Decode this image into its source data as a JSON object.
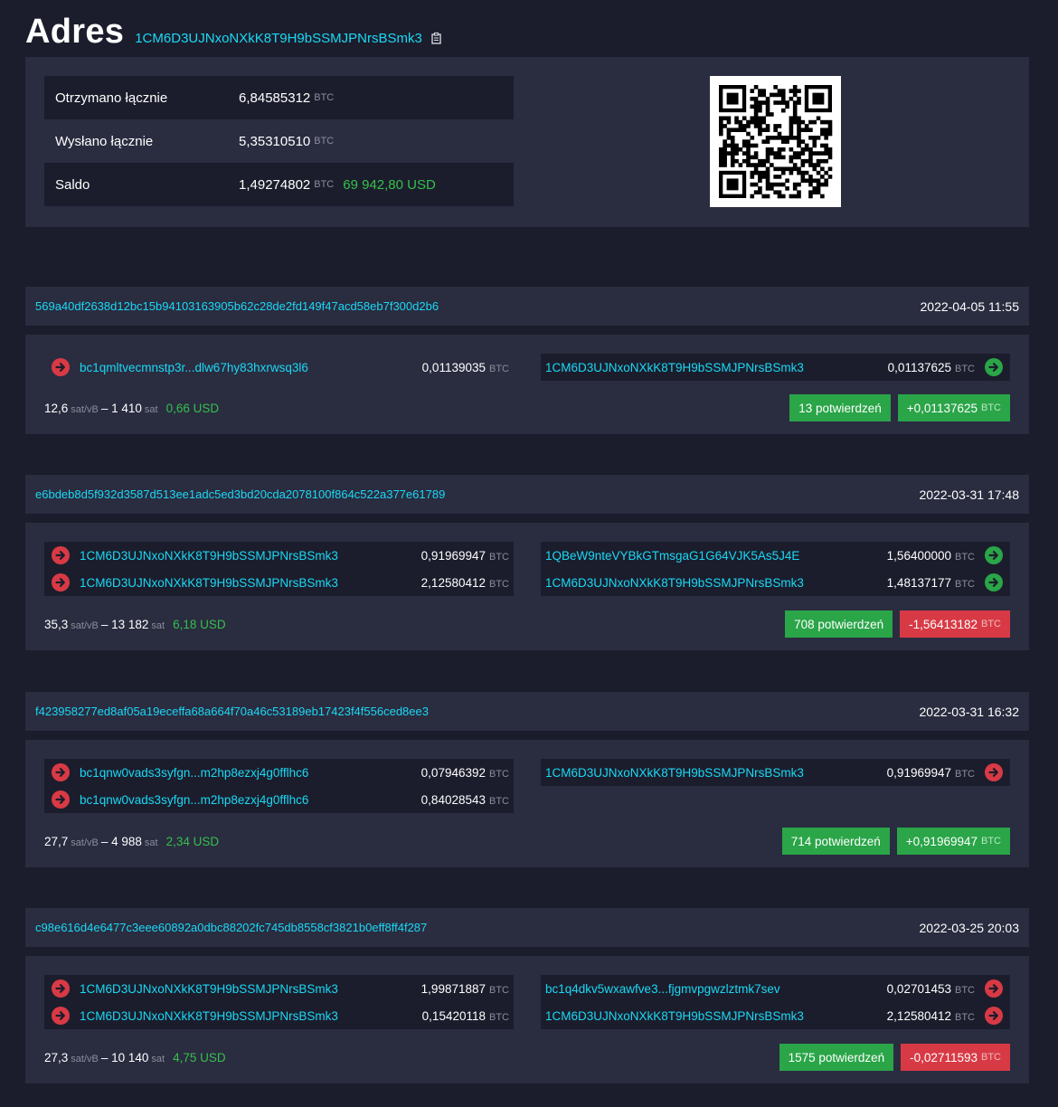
{
  "header": {
    "title": "Adres",
    "address": "1CM6D3UJNxoNXkK8T9H9bSSMJPNrsBSmk3"
  },
  "summary": {
    "rows": [
      {
        "label": "Otrzymano łącznie",
        "value": "6,84585312",
        "unit": "BTC",
        "usd": ""
      },
      {
        "label": "Wysłano łącznie",
        "value": "5,35310510",
        "unit": "BTC",
        "usd": ""
      },
      {
        "label": "Saldo",
        "value": "1,49274802",
        "unit": "BTC",
        "usd": "69 942,80 USD"
      }
    ]
  },
  "transactions": [
    {
      "txid": "569a40df2638d12bc15b94103163905b62c28de2fd149f47acd58eb7f300d2b6",
      "date": "2022-04-05 11:55",
      "inputs": [
        {
          "address": "bc1qmltvecmnstp3r...dlw67hy83hxrwsq3l6",
          "amount": "0,01139035",
          "unit": "BTC"
        }
      ],
      "outputs": [
        {
          "address": "1CM6D3UJNxoNXkK8T9H9bSSMJPNrsBSmk3",
          "amount": "0,01137625",
          "unit": "BTC",
          "icon": "green"
        }
      ],
      "fee_rate": "12,6",
      "fee_rate_unit": "sat/vB",
      "fee_sat": "1 410",
      "fee_sat_unit": "sat",
      "fee_usd": "0,66 USD",
      "confirmations": "13 potwierdzeń",
      "delta": "+0,01137625",
      "delta_unit": "BTC",
      "delta_color": "green"
    },
    {
      "txid": "e6bdeb8d5f932d3587d513ee1adc5ed3bd20cda2078100f864c522a377e61789",
      "date": "2022-03-31 17:48",
      "inputs": [
        {
          "address": "1CM6D3UJNxoNXkK8T9H9bSSMJPNrsBSmk3",
          "amount": "0,91969947",
          "unit": "BTC"
        },
        {
          "address": "1CM6D3UJNxoNXkK8T9H9bSSMJPNrsBSmk3",
          "amount": "2,12580412",
          "unit": "BTC"
        }
      ],
      "outputs": [
        {
          "address": "1QBeW9nteVYBkGTmsgaG1G64VJK5As5J4E",
          "amount": "1,56400000",
          "unit": "BTC",
          "icon": "green"
        },
        {
          "address": "1CM6D3UJNxoNXkK8T9H9bSSMJPNrsBSmk3",
          "amount": "1,48137177",
          "unit": "BTC",
          "icon": "green"
        }
      ],
      "fee_rate": "35,3",
      "fee_rate_unit": "sat/vB",
      "fee_sat": "13 182",
      "fee_sat_unit": "sat",
      "fee_usd": "6,18 USD",
      "confirmations": "708 potwierdzeń",
      "delta": "-1,56413182",
      "delta_unit": "BTC",
      "delta_color": "red"
    },
    {
      "txid": "f423958277ed8af05a19eceffa68a664f70a46c53189eb17423f4f556ced8ee3",
      "date": "2022-03-31 16:32",
      "inputs": [
        {
          "address": "bc1qnw0vads3syfgn...m2hp8ezxj4g0fflhc6",
          "amount": "0,07946392",
          "unit": "BTC"
        },
        {
          "address": "bc1qnw0vads3syfgn...m2hp8ezxj4g0fflhc6",
          "amount": "0,84028543",
          "unit": "BTC"
        }
      ],
      "outputs": [
        {
          "address": "1CM6D3UJNxoNXkK8T9H9bSSMJPNrsBSmk3",
          "amount": "0,91969947",
          "unit": "BTC",
          "icon": "red"
        }
      ],
      "fee_rate": "27,7",
      "fee_rate_unit": "sat/vB",
      "fee_sat": "4 988",
      "fee_sat_unit": "sat",
      "fee_usd": "2,34 USD",
      "confirmations": "714 potwierdzeń",
      "delta": "+0,91969947",
      "delta_unit": "BTC",
      "delta_color": "green"
    },
    {
      "txid": "c98e616d4e6477c3eee60892a0dbc88202fc745db8558cf3821b0eff8ff4f287",
      "date": "2022-03-25 20:03",
      "inputs": [
        {
          "address": "1CM6D3UJNxoNXkK8T9H9bSSMJPNrsBSmk3",
          "amount": "1,99871887",
          "unit": "BTC"
        },
        {
          "address": "1CM6D3UJNxoNXkK8T9H9bSSMJPNrsBSmk3",
          "amount": "0,15420118",
          "unit": "BTC"
        }
      ],
      "outputs": [
        {
          "address": "bc1q4dkv5wxawfve3...fjgmvpgwzlztmk7sev",
          "amount": "0,02701453",
          "unit": "BTC",
          "icon": "red"
        },
        {
          "address": "1CM6D3UJNxoNXkK8T9H9bSSMJPNrsBSmk3",
          "amount": "2,12580412",
          "unit": "BTC",
          "icon": "red"
        }
      ],
      "fee_rate": "27,3",
      "fee_rate_unit": "sat/vB",
      "fee_sat": "10 140",
      "fee_sat_unit": "sat",
      "fee_usd": "4,75 USD",
      "confirmations": "1575 potwierdzeń",
      "delta": "-0,02711593",
      "delta_unit": "BTC",
      "delta_color": "red"
    }
  ]
}
